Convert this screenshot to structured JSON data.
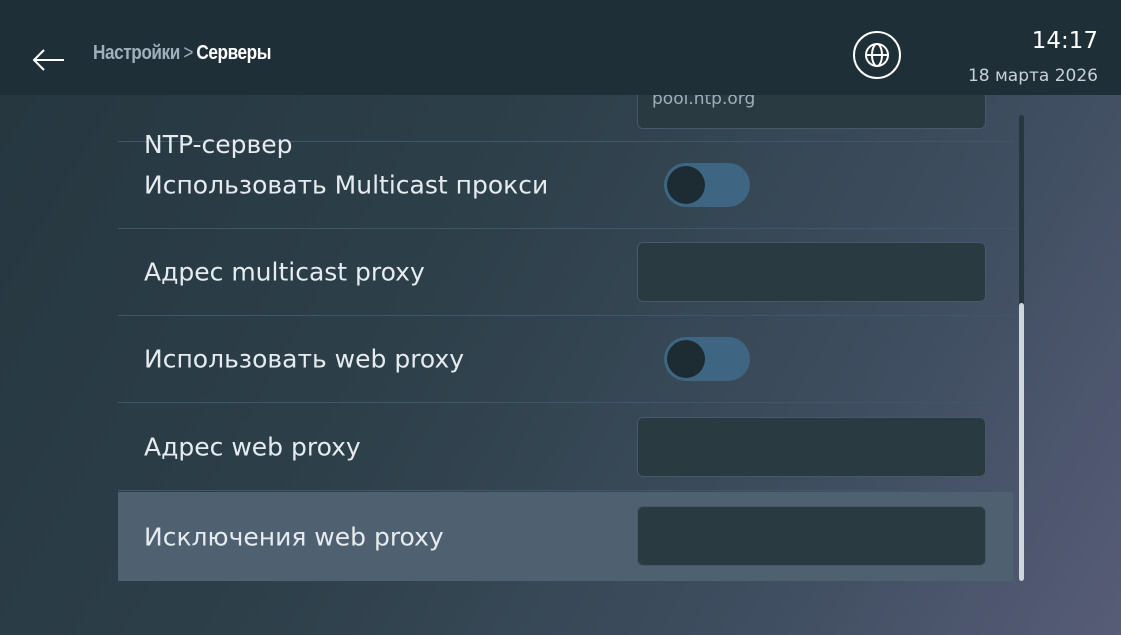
{
  "header": {
    "breadcrumb_parent": "Настройки",
    "breadcrumb_separator": ">",
    "breadcrumb_current": "Серверы",
    "time": "14:17",
    "date": "18 марта 2026"
  },
  "settings": {
    "rows": [
      {
        "label": "NTP-сервер",
        "type": "input",
        "value": "pool.ntp.org"
      },
      {
        "label": "Использовать Multicast прокси",
        "type": "toggle",
        "on": false
      },
      {
        "label": "Адрес multicast proxy",
        "type": "input",
        "value": ""
      },
      {
        "label": "Использовать web proxy",
        "type": "toggle",
        "on": false
      },
      {
        "label": "Адрес web proxy",
        "type": "input",
        "value": ""
      },
      {
        "label": "Исключения web proxy",
        "type": "input",
        "value": "",
        "selected": true
      }
    ]
  },
  "scroll": {
    "position_fraction": 1.0
  },
  "colors": {
    "header_bg": "#1f2f37",
    "toggle_track": "#3e6683",
    "selected_row": "#4f6070"
  },
  "icons": [
    "back-arrow-icon",
    "globe-icon"
  ]
}
